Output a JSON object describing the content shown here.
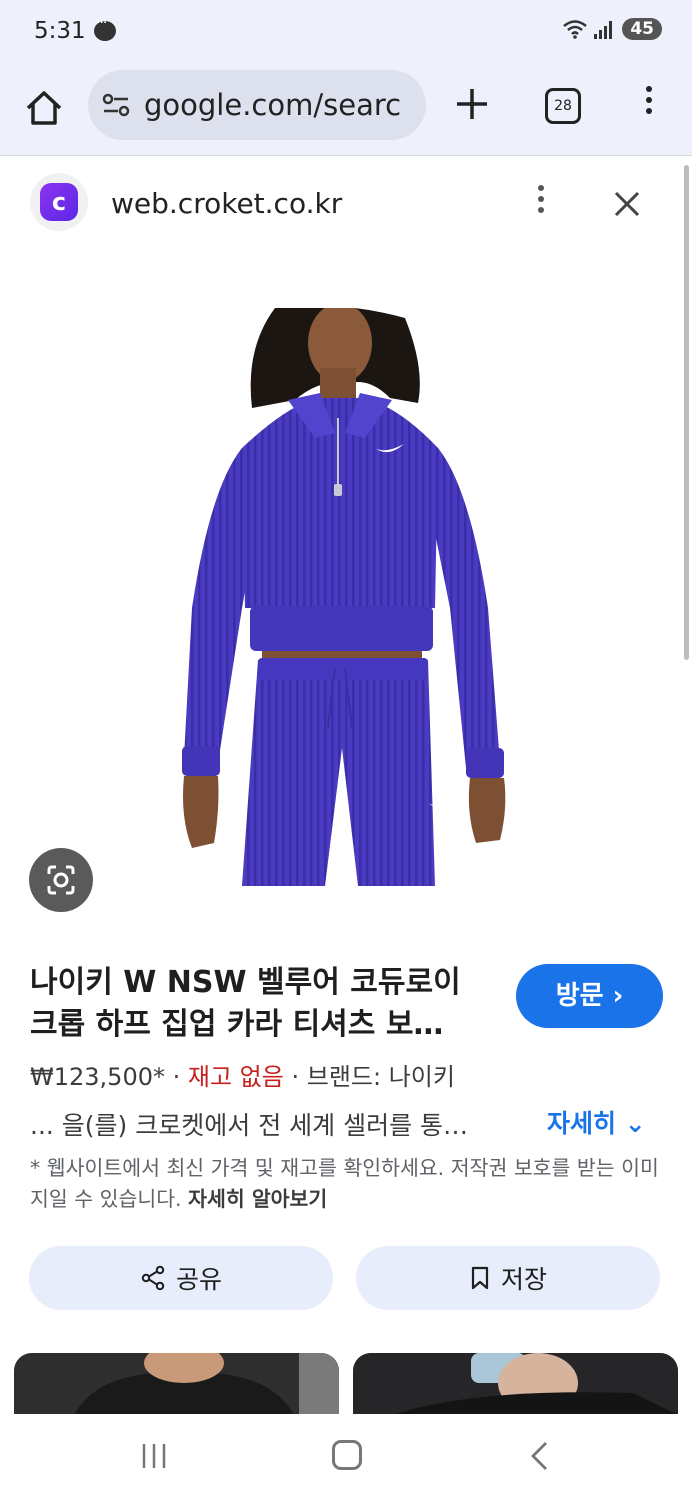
{
  "status_bar": {
    "time": "5:31",
    "battery": "45"
  },
  "browser": {
    "url": "google.com/searc",
    "tab_count": "28"
  },
  "site": {
    "logo_letter": "c",
    "domain": "web.croket.co.kr"
  },
  "result": {
    "title": "나이키 W NSW 벨루어 코듀로이 크롭 하프 집업 카라 티셔츠 보…",
    "visit_label": "방문 ›",
    "price": "₩123,500*",
    "stock": "재고 없음",
    "brand": "브랜드: 나이키",
    "description": "... 을(를) 크로켓에서 전 세계 셀러를 통…",
    "detail_label": "자세히 ⌄",
    "notice": "* 웹사이트에서 최신 가격 및 재고를 확인하세요. 저작권 보호를 받는 이미지일 수 있습니다.",
    "learn_more": "자세히 알아보기"
  },
  "actions": {
    "share_label": "공유",
    "save_label": "저장"
  },
  "colors": {
    "accent": "#1a73e8",
    "product": "#4b3ac0",
    "stock_red": "#c5221f"
  }
}
